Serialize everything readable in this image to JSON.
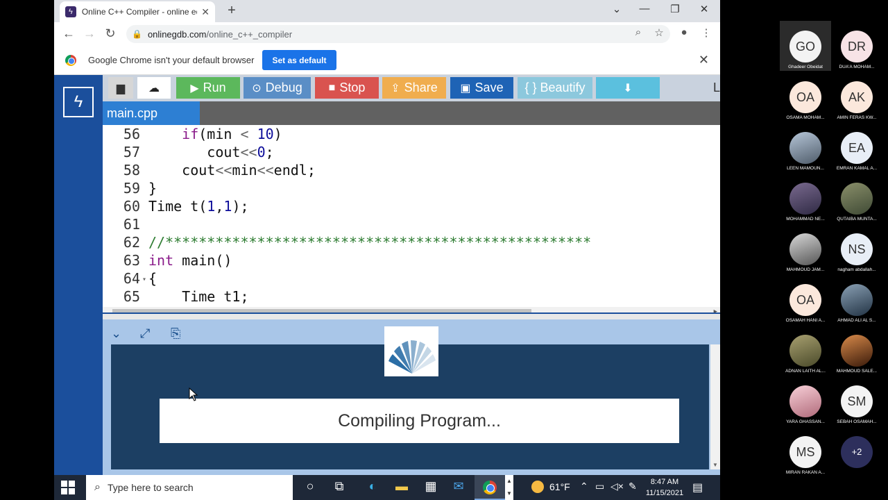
{
  "browser": {
    "tab_title": "Online C++ Compiler - online ed",
    "tab_icon": "onlinegdb-favicon",
    "url_host": "onlinegdb.com",
    "url_path": "/online_c++_compiler",
    "infobar": {
      "message": "Google Chrome isn't your default browser",
      "button": "Set as default"
    }
  },
  "toolbar": {
    "run": "Run",
    "debug": "Debug",
    "stop": "Stop",
    "share": "Share",
    "save": "Save",
    "beautify": "{ } Beautify",
    "language_cut": "L"
  },
  "file_tab": "main.cpp",
  "editor": {
    "lines": [
      {
        "n": "56",
        "fold": "",
        "indent": "    ",
        "tokens": [
          [
            "kw",
            "if"
          ],
          [
            "code",
            "(min "
          ],
          [
            "op",
            "<"
          ],
          [
            "code",
            " "
          ],
          [
            "num",
            "10"
          ],
          [
            "code",
            ")"
          ]
        ]
      },
      {
        "n": "57",
        "fold": "",
        "indent": "       ",
        "tokens": [
          [
            "code",
            "cout"
          ],
          [
            "op",
            "<<"
          ],
          [
            "num",
            "0"
          ],
          [
            "code",
            ";"
          ]
        ]
      },
      {
        "n": "58",
        "fold": "",
        "indent": "    ",
        "tokens": [
          [
            "code",
            "cout"
          ],
          [
            "op",
            "<<"
          ],
          [
            "code",
            "min"
          ],
          [
            "op",
            "<<"
          ],
          [
            "code",
            "endl;"
          ]
        ]
      },
      {
        "n": "59",
        "fold": "",
        "indent": "",
        "tokens": [
          [
            "code",
            "}"
          ]
        ]
      },
      {
        "n": "60",
        "fold": "",
        "indent": "",
        "tokens": [
          [
            "code",
            "Time t("
          ],
          [
            "num",
            "1"
          ],
          [
            "code",
            ","
          ],
          [
            "num",
            "1"
          ],
          [
            "code",
            ");"
          ]
        ]
      },
      {
        "n": "61",
        "fold": "",
        "indent": "",
        "tokens": []
      },
      {
        "n": "62",
        "fold": "",
        "indent": "",
        "tokens": [
          [
            "cm",
            "//***************************************************"
          ]
        ]
      },
      {
        "n": "63",
        "fold": "",
        "indent": "",
        "tokens": [
          [
            "kw",
            "int"
          ],
          [
            "code",
            " main()"
          ]
        ]
      },
      {
        "n": "64",
        "fold": "▾",
        "indent": "",
        "tokens": [
          [
            "code",
            "{"
          ]
        ]
      },
      {
        "n": "65",
        "fold": "",
        "indent": "    ",
        "tokens": [
          [
            "code",
            "Time t1;"
          ]
        ]
      }
    ]
  },
  "output": {
    "status": "Compiling Program..."
  },
  "taskbar": {
    "search_placeholder": "Type here to search",
    "weather": "61°F",
    "time": "8:47 AM",
    "date": "11/15/2021"
  },
  "participants": [
    {
      "initials": "GO",
      "name": "Ghadeer Obeidat",
      "style": "init",
      "active": true
    },
    {
      "initials": "DR",
      "name": "DUA'A MOHAM...",
      "style": "init pink"
    },
    {
      "initials": "OA",
      "name": "OSAMA MOHAM...",
      "style": "init peach"
    },
    {
      "initials": "AK",
      "name": "AMIN FERAS KW...",
      "style": "init peach"
    },
    {
      "initials": "",
      "name": "LEEN MAMOUN...",
      "style": "photo p1"
    },
    {
      "initials": "EA",
      "name": "EMRAN KAMAL A...",
      "style": "init blue"
    },
    {
      "initials": "",
      "name": "MOHAMMAD NE...",
      "style": "photo p3"
    },
    {
      "initials": "",
      "name": "QUTAIBA MUNTA...",
      "style": "photo p2"
    },
    {
      "initials": "",
      "name": "MAHMOUD JAM...",
      "style": "photo p5"
    },
    {
      "initials": "NS",
      "name": "nagham abdallah...",
      "style": "init blue"
    },
    {
      "initials": "OA",
      "name": "OSAMAH HANI A...",
      "style": "init peach"
    },
    {
      "initials": "",
      "name": "AHMAD ALI AL S...",
      "style": "photo p6"
    },
    {
      "initials": "",
      "name": "ADNAN LAITH AL...",
      "style": "photo p7"
    },
    {
      "initials": "",
      "name": "MAHMOUD SALE...",
      "style": "photo p8"
    },
    {
      "initials": "",
      "name": "YARA GHASSAN...",
      "style": "photo p9"
    },
    {
      "initials": "SM",
      "name": "SEBAH OSAMAH...",
      "style": "init"
    },
    {
      "initials": "MS",
      "name": "MIRAN RAKAN A...",
      "style": "init"
    },
    {
      "initials": "+2",
      "name": "",
      "style": "more"
    }
  ]
}
